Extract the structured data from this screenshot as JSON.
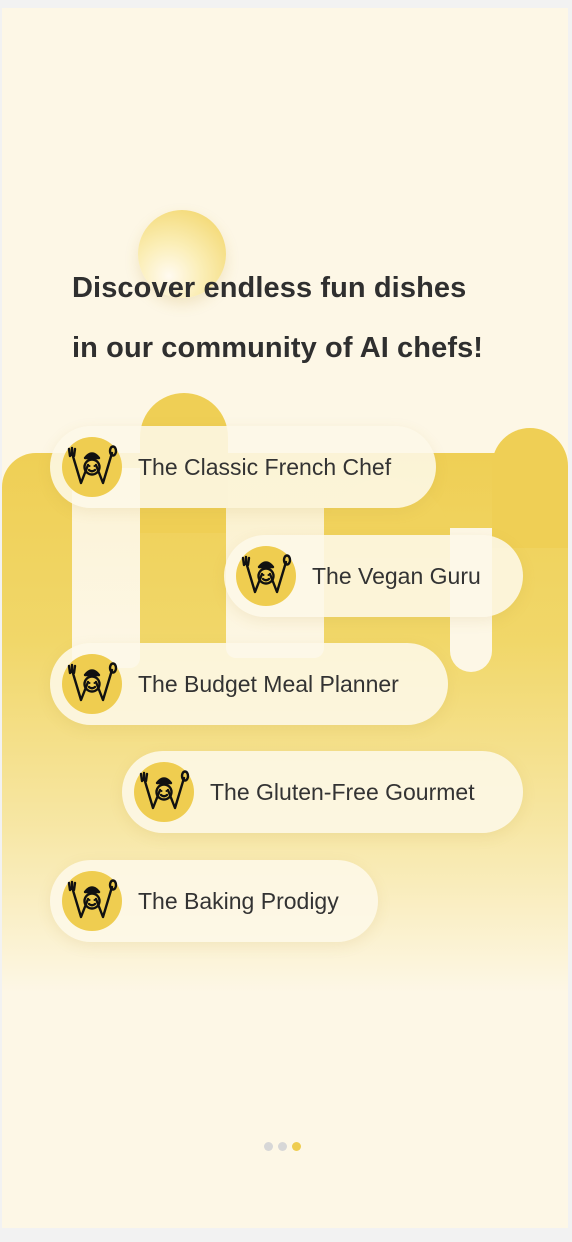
{
  "headline": {
    "line1": "Discover endless fun dishes",
    "line2": "in our community of AI chefs!"
  },
  "chefs": [
    {
      "name": "The Classic French Chef",
      "icon": "chef-logo-icon"
    },
    {
      "name": "The Vegan Guru",
      "icon": "chef-logo-icon"
    },
    {
      "name": "The Budget Meal Planner",
      "icon": "chef-logo-icon"
    },
    {
      "name": "The Gluten-Free Gourmet",
      "icon": "chef-logo-icon"
    },
    {
      "name": "The Baking Prodigy",
      "icon": "chef-logo-icon"
    }
  ],
  "pager": {
    "total": 3,
    "active": 3
  },
  "colors": {
    "background": "#fdf7e6",
    "accent": "#efcd50",
    "text": "#333333",
    "dot_inactive": "#d7d7d7"
  }
}
